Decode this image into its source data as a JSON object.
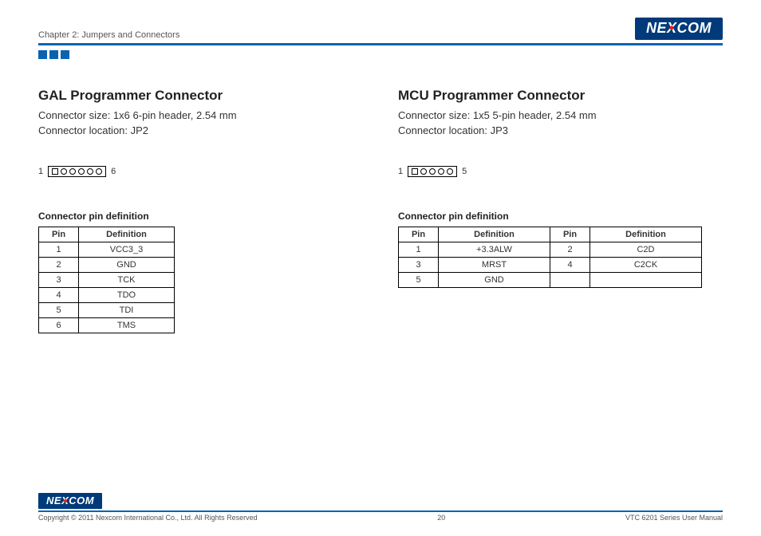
{
  "header": {
    "chapter": "Chapter 2: Jumpers and Connectors",
    "logo": "NEXCOM"
  },
  "left": {
    "title": "GAL Programmer Connector",
    "size": "Connector size:  1x6 6-pin header, 2.54 mm",
    "location": "Connector location: JP2",
    "diagram_start": "1",
    "diagram_end": "6",
    "table_caption": "Connector pin definition",
    "table": {
      "headers": [
        "Pin",
        "Definition"
      ],
      "rows": [
        [
          "1",
          "VCC3_3"
        ],
        [
          "2",
          "GND"
        ],
        [
          "3",
          "TCK"
        ],
        [
          "4",
          "TDO"
        ],
        [
          "5",
          "TDI"
        ],
        [
          "6",
          "TMS"
        ]
      ]
    }
  },
  "right": {
    "title": "MCU Programmer Connector",
    "size": "Connector size: 1x5 5-pin header, 2.54 mm",
    "location": "Connector location: JP3",
    "diagram_start": "1",
    "diagram_end": "5",
    "table_caption": "Connector pin definition",
    "table": {
      "headers": [
        "Pin",
        "Definition",
        "Pin",
        "Definition"
      ],
      "rows": [
        [
          "1",
          "+3.3ALW",
          "2",
          "C2D"
        ],
        [
          "3",
          "MRST",
          "4",
          "C2CK"
        ],
        [
          "5",
          "GND",
          "",
          ""
        ]
      ]
    }
  },
  "footer": {
    "copyright": "Copyright © 2011 Nexcom International Co., Ltd. All Rights Reserved",
    "page": "20",
    "doc": "VTC 6201 Series User Manual"
  }
}
